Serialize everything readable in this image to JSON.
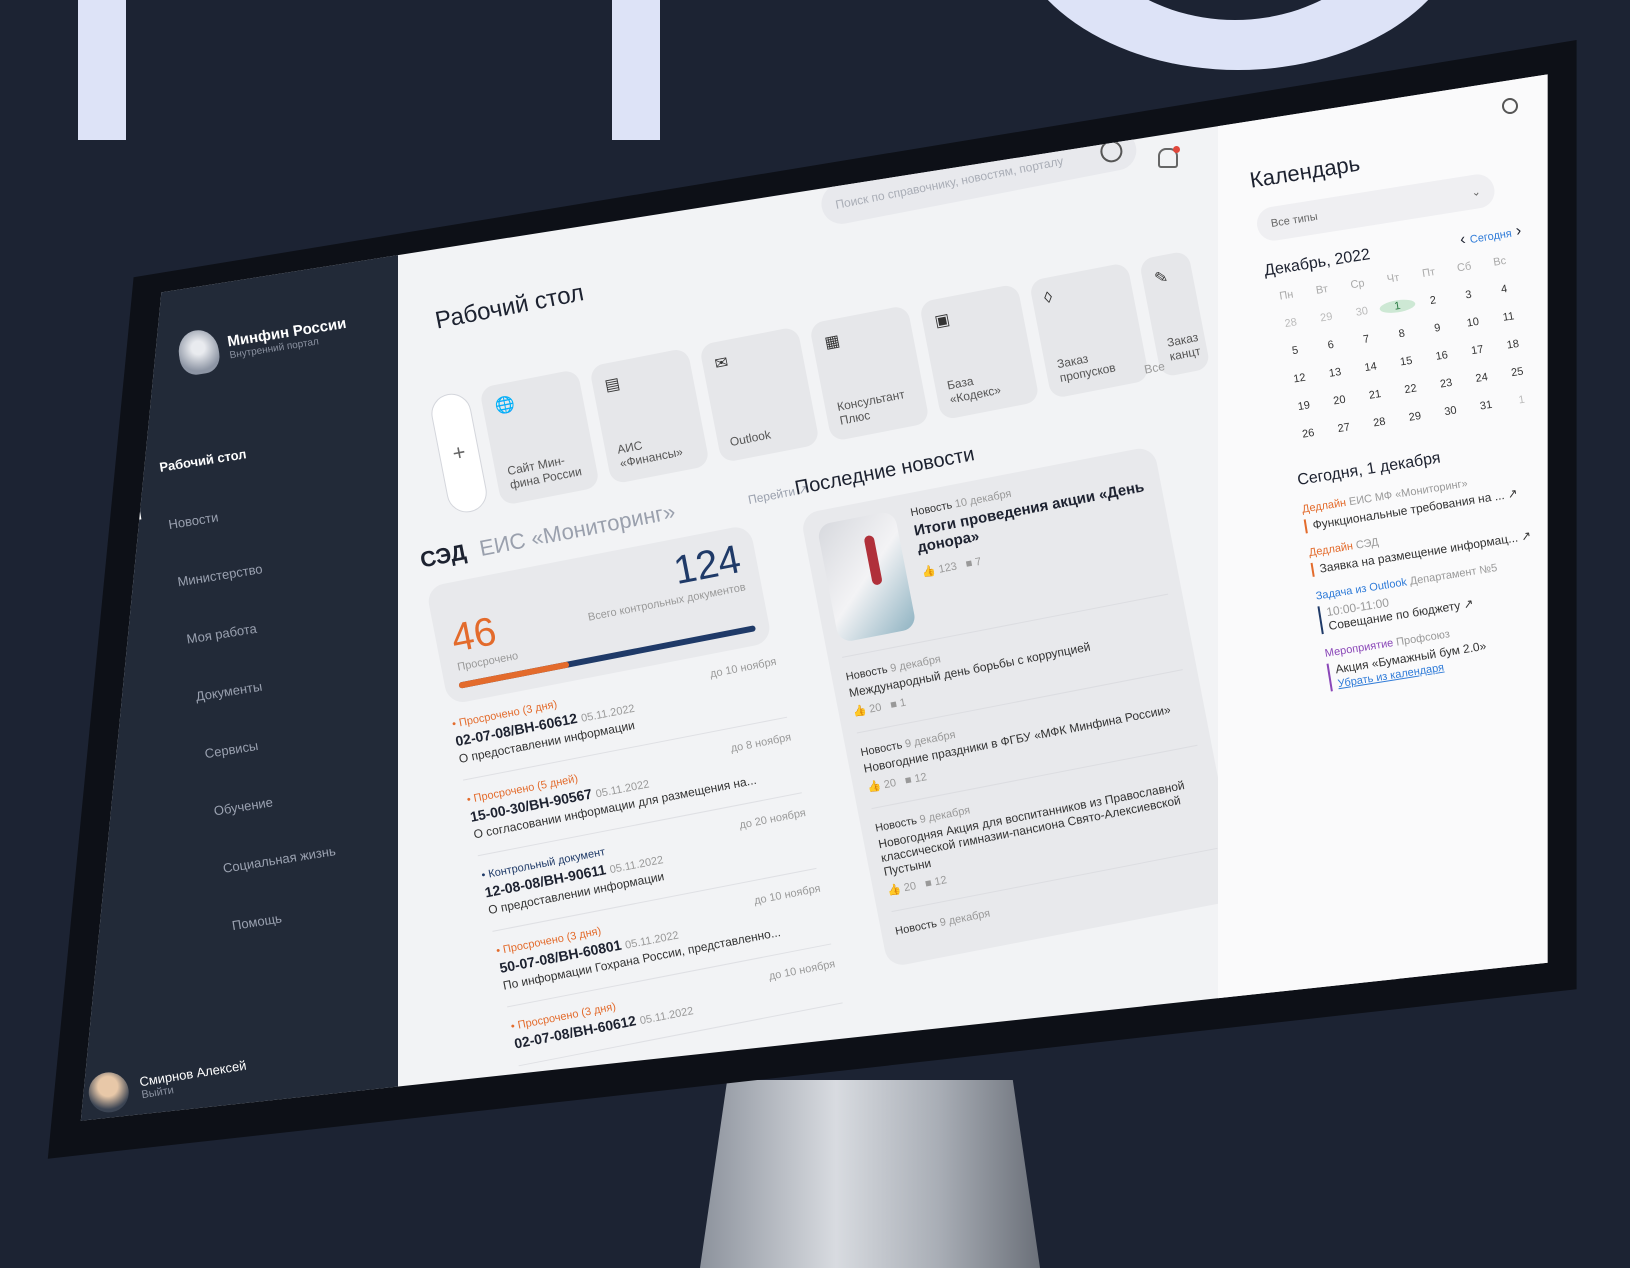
{
  "sidebar": {
    "brand": "Минфин России",
    "subtitle": "Внутренний портал",
    "items": [
      {
        "label": "Рабочий стол"
      },
      {
        "label": "Новости"
      },
      {
        "label": "Министерство"
      },
      {
        "label": "Моя работа"
      },
      {
        "label": "Документы"
      },
      {
        "label": "Сервисы"
      },
      {
        "label": "Обучение"
      },
      {
        "label": "Социальная жизнь"
      },
      {
        "label": "Помощь"
      }
    ],
    "user": {
      "name": "Смирнов Алексей",
      "action": "Выйти"
    }
  },
  "header": {
    "title": "Рабочий стол",
    "search_placeholder": "Поиск по справочнику, новостям, порталу"
  },
  "tiles": [
    {
      "label": "Сайт Мин-фина России",
      "icon": "🌐"
    },
    {
      "label": "АИС «Финансы»",
      "icon": "▤"
    },
    {
      "label": "Outlook",
      "icon": "✉"
    },
    {
      "label": "Консультант Плюс",
      "icon": "▦"
    },
    {
      "label": "База «Кодекс»",
      "icon": "▣"
    },
    {
      "label": "Заказ пропусков",
      "icon": "◊"
    },
    {
      "label": "Заказ канцт",
      "icon": "✎"
    }
  ],
  "tiles_all": "Все",
  "docs": {
    "tab_active": "СЭД",
    "tab_other": "ЕИС «Мониторинг»",
    "goto": "Перейти ↗",
    "overdue_count": "46",
    "overdue_label": "Просрочено",
    "total_count": "124",
    "total_label": "Всего контрольных документов",
    "overdue_fraction": 0.37,
    "items": [
      {
        "status": "• Просрочено (3 дня)",
        "deadline": "до 10 ноября",
        "number": "02-07-08/ВН-60612",
        "date": "05.11.2022",
        "desc": "О предоставлении информации"
      },
      {
        "status": "• Просрочено (5 дней)",
        "deadline": "до 8 ноября",
        "number": "15-00-30/ВН-90567",
        "date": "05.11.2022",
        "desc": "О согласовании информации для размещения на..."
      },
      {
        "status": "• Контрольный документ",
        "deadline": "до 20 ноября",
        "number": "12-08-08/ВН-90611",
        "date": "05.11.2022",
        "desc": "О предоставлении информации"
      },
      {
        "status": "• Просрочено (3 дня)",
        "deadline": "до 10 ноября",
        "number": "50-07-08/ВН-60801",
        "date": "05.11.2022",
        "desc": "По информации Гохрана России, представленно..."
      },
      {
        "status": "• Просрочено (3 дня)",
        "deadline": "до 10 ноября",
        "number": "02-07-08/ВН-60612",
        "date": "05.11.2022",
        "desc": ""
      }
    ]
  },
  "news": {
    "title": "Последние новости",
    "featured": {
      "type": "Новость",
      "date": "10 декабря",
      "headline": "Итоги проведения акции «День донора»",
      "likes": "123",
      "comments": "7"
    },
    "items": [
      {
        "type": "Новость",
        "date": "9 декабря",
        "text": "Международный день борьбы с коррупцией",
        "likes": "20",
        "comments": "1"
      },
      {
        "type": "Новость",
        "date": "9 декабря",
        "text": "Новогодние праздники в ФГБУ «МФК Минфина России»",
        "likes": "20",
        "comments": "12"
      },
      {
        "type": "Новость",
        "date": "9 декабря",
        "text": "Новогодняя Акция для воспитанников из Православной классической гимназии-пансиона Свято-Алексиевской Пустыни",
        "likes": "20",
        "comments": "12"
      },
      {
        "type": "Новость",
        "date": "9 декабря",
        "text": "",
        "likes": "",
        "comments": ""
      }
    ]
  },
  "calendar": {
    "title": "Календарь",
    "filter": "Все типы",
    "month": "Декабрь, 2022",
    "today_link": "Сегодня",
    "weekdays": [
      "Пн",
      "Вт",
      "Ср",
      "Чт",
      "Пт",
      "Сб",
      "Вс"
    ],
    "days": [
      "28",
      "29",
      "30",
      "1",
      "2",
      "3",
      "4",
      "5",
      "6",
      "7",
      "8",
      "9",
      "10",
      "11",
      "12",
      "13",
      "14",
      "15",
      "16",
      "17",
      "18",
      "19",
      "20",
      "21",
      "22",
      "23",
      "24",
      "25",
      "26",
      "27",
      "28",
      "29",
      "30",
      "31",
      "1"
    ],
    "today_header": "Сегодня, 1 декабря",
    "events": [
      {
        "type": "Дедлайн",
        "source": "ЕИС МФ «Мониторинг»",
        "text": "Функциональные требования на ... ↗",
        "color": "orange"
      },
      {
        "type": "Дедлайн",
        "source": "СЭД",
        "text": "Заявка на размещение информац... ↗",
        "color": "orange"
      },
      {
        "type": "Задача из Outlook",
        "source": "Департамент №5",
        "time": "10:00-11:00",
        "text": "Совещание по бюджету ↗",
        "color": "blue"
      },
      {
        "type": "Мероприятие",
        "source": "Профсоюз",
        "text": "Акция «Бумажный бум 2.0»",
        "link": "Убрать из календаря",
        "color": "purple"
      }
    ]
  },
  "colors": {
    "accent_orange": "#e36b2c",
    "accent_blue": "#1f3a68",
    "sidebar_bg": "#222a38",
    "page_bg": "#1c2333"
  }
}
